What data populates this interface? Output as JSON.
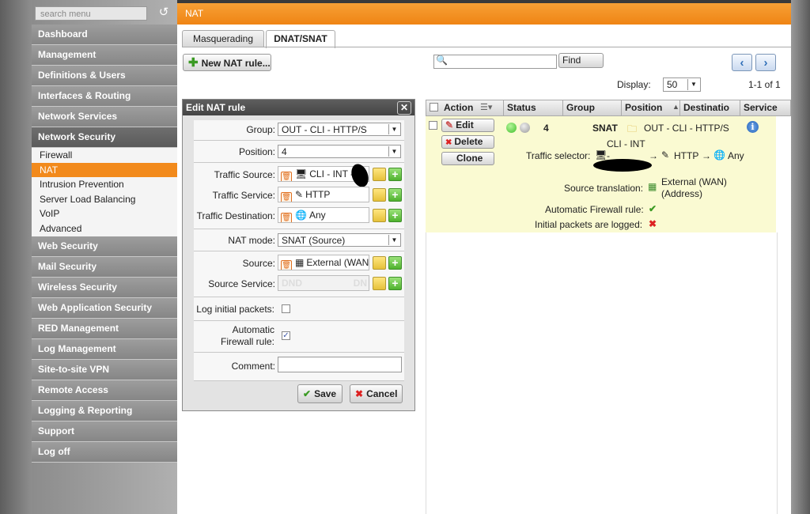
{
  "sidebar": {
    "search_placeholder": "search menu",
    "items": [
      {
        "label": "Dashboard"
      },
      {
        "label": "Management"
      },
      {
        "label": "Definitions & Users"
      },
      {
        "label": "Interfaces & Routing"
      },
      {
        "label": "Network Services"
      },
      {
        "label": "Network Security",
        "active": true
      }
    ],
    "subitems": [
      {
        "label": "Firewall"
      },
      {
        "label": "NAT",
        "active": true
      },
      {
        "label": "Intrusion Prevention"
      },
      {
        "label": "Server Load Balancing"
      },
      {
        "label": "VoIP"
      },
      {
        "label": "Advanced"
      }
    ],
    "items_after": [
      {
        "label": "Web Security"
      },
      {
        "label": "Mail Security"
      },
      {
        "label": "Wireless Security"
      },
      {
        "label": "Web Application Security"
      },
      {
        "label": "RED Management"
      },
      {
        "label": "Log Management"
      },
      {
        "label": "Site-to-site VPN"
      },
      {
        "label": "Remote Access"
      },
      {
        "label": "Logging & Reporting"
      },
      {
        "label": "Support"
      },
      {
        "label": "Log off"
      }
    ]
  },
  "header": {
    "title": "NAT"
  },
  "tabs": [
    {
      "label": "Masquerading",
      "active": false
    },
    {
      "label": "DNAT/SNAT",
      "active": true
    }
  ],
  "toolbar": {
    "new_rule_label": "New NAT rule...",
    "find_label": "Find",
    "display_label": "Display:",
    "display_value": "50",
    "pager_text": "1-1 of 1"
  },
  "dialog": {
    "title": "Edit NAT rule",
    "close_glyph": "✕",
    "fields": {
      "group_label": "Group:",
      "group_value": "OUT - CLI - HTTP/S",
      "position_label": "Position:",
      "position_value": "4",
      "traffic_source_label": "Traffic Source:",
      "traffic_source_value": "CLI - INT -",
      "traffic_service_label": "Traffic Service:",
      "traffic_service_value": "HTTP",
      "traffic_destination_label": "Traffic Destination:",
      "traffic_destination_value": "Any",
      "nat_mode_label": "NAT mode:",
      "nat_mode_value": "SNAT (Source)",
      "source_label": "Source:",
      "source_value": "External (WAN",
      "source_service_label": "Source Service:",
      "source_service_placeholder": "DND",
      "source_service_placeholder_right": "DN",
      "log_label": "Log initial packets:",
      "log_checked": false,
      "auto_fw_label_1": "Automatic",
      "auto_fw_label_2": "Firewall rule:",
      "auto_fw_checked": true,
      "comment_label": "Comment:",
      "comment_value": ""
    },
    "save_label": "Save",
    "cancel_label": "Cancel"
  },
  "table": {
    "columns": [
      "Action",
      "Status",
      "Group",
      "Position",
      "Destinatio",
      "Service"
    ],
    "row": {
      "edit_label": "Edit",
      "delete_label": "Delete",
      "clone_label": "Clone",
      "position": "4",
      "mode": "SNAT",
      "group": "OUT - CLI - HTTP/S",
      "name": "CLI - INT",
      "traffic_selector_label": "Traffic selector:",
      "traffic_selector_source": "-",
      "traffic_selector_service": "HTTP",
      "traffic_selector_dest": "Any",
      "arrow": "→",
      "source_translation_label": "Source translation:",
      "source_translation_value_1": "External (WAN)",
      "source_translation_value_2": "(Address)",
      "auto_fw_label": "Automatic Firewall rule:",
      "auto_fw_glyph": "✔",
      "log_label": "Initial packets are logged:",
      "log_glyph": "✖"
    }
  },
  "colors": {
    "accent": "#f28a1c",
    "row_highlight": "#fafad2",
    "status_on": "#3fbf2a"
  }
}
